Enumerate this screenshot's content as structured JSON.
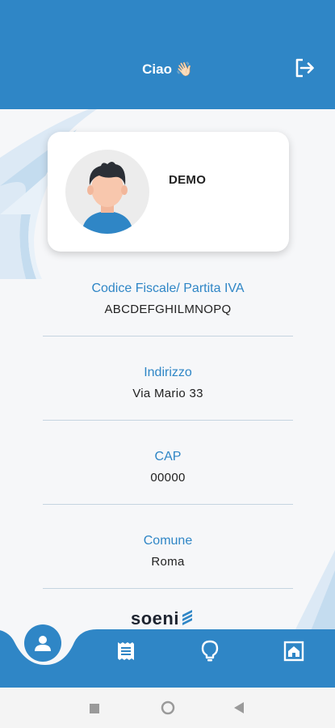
{
  "header": {
    "greeting": "Ciao 👋🏻"
  },
  "profile": {
    "name": "DEMO"
  },
  "fields": [
    {
      "label": "Codice Fiscale/ Partita IVA",
      "value": "ABCDEFGHILMNOPQ"
    },
    {
      "label": "Indirizzo",
      "value": "Via Mario 33"
    },
    {
      "label": "CAP",
      "value": "00000"
    },
    {
      "label": "Comune",
      "value": "Roma"
    }
  ],
  "brand": {
    "name": "soeni"
  },
  "navbar": {
    "items": [
      "profile-icon",
      "receipt-icon",
      "lightbulb-icon",
      "home-photo-icon"
    ],
    "active": "profile-icon"
  },
  "colors": {
    "primary": "#2f86c6",
    "accent_light": "#d4e6f4"
  }
}
